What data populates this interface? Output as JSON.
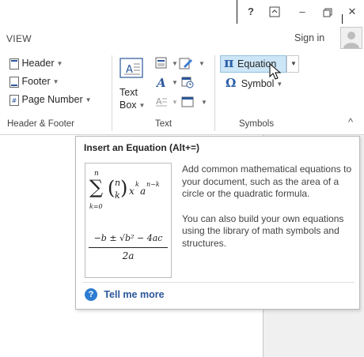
{
  "titlebar": {
    "help_glyph": "?",
    "ribbon_opts_glyph": "⊼",
    "minimize_glyph": "–",
    "restore_glyph": "⧉",
    "close_glyph": "✕"
  },
  "tabs": {
    "view": "VIEW",
    "sign_in": "Sign in"
  },
  "ribbon": {
    "header_footer": {
      "header": "Header",
      "footer": "Footer",
      "page_number": "Page Number",
      "group_label": "Header & Footer"
    },
    "text": {
      "text_box_line1": "Text",
      "text_box_line2": "Box",
      "group_label": "Text"
    },
    "symbols": {
      "pi_glyph": "π",
      "equation": "Equation",
      "omega_glyph": "Ω",
      "symbol": "Symbol",
      "group_label": "Symbols"
    },
    "collapse_glyph": "^"
  },
  "tooltip": {
    "title": "Insert an Equation (Alt+=)",
    "desc_para1": "Add common mathematical equations to your document, such as the area of a circle or the quadratic formula.",
    "desc_para2": "You can also build your own equations using the library of math symbols and structures.",
    "tell_me_more": "Tell me more",
    "help_glyph": "?",
    "formula1": {
      "sum_top": "n",
      "sum_bottom": "k=0",
      "sigma": "∑",
      "binom_top": "n",
      "binom_bottom": "k",
      "rest": "x",
      "exp_k": "k",
      "a": "a",
      "exp_nk": "n−k"
    },
    "formula2": {
      "numerator": "−b ± √b² − 4ac",
      "denominator": "2a"
    }
  },
  "colors": {
    "accent_blue": "#2b579a",
    "symbol_blue": "#2b5fa8",
    "selected_bg": "#cde6f7",
    "selected_border": "#92c0e0",
    "help_blue": "#2c7cd1"
  }
}
